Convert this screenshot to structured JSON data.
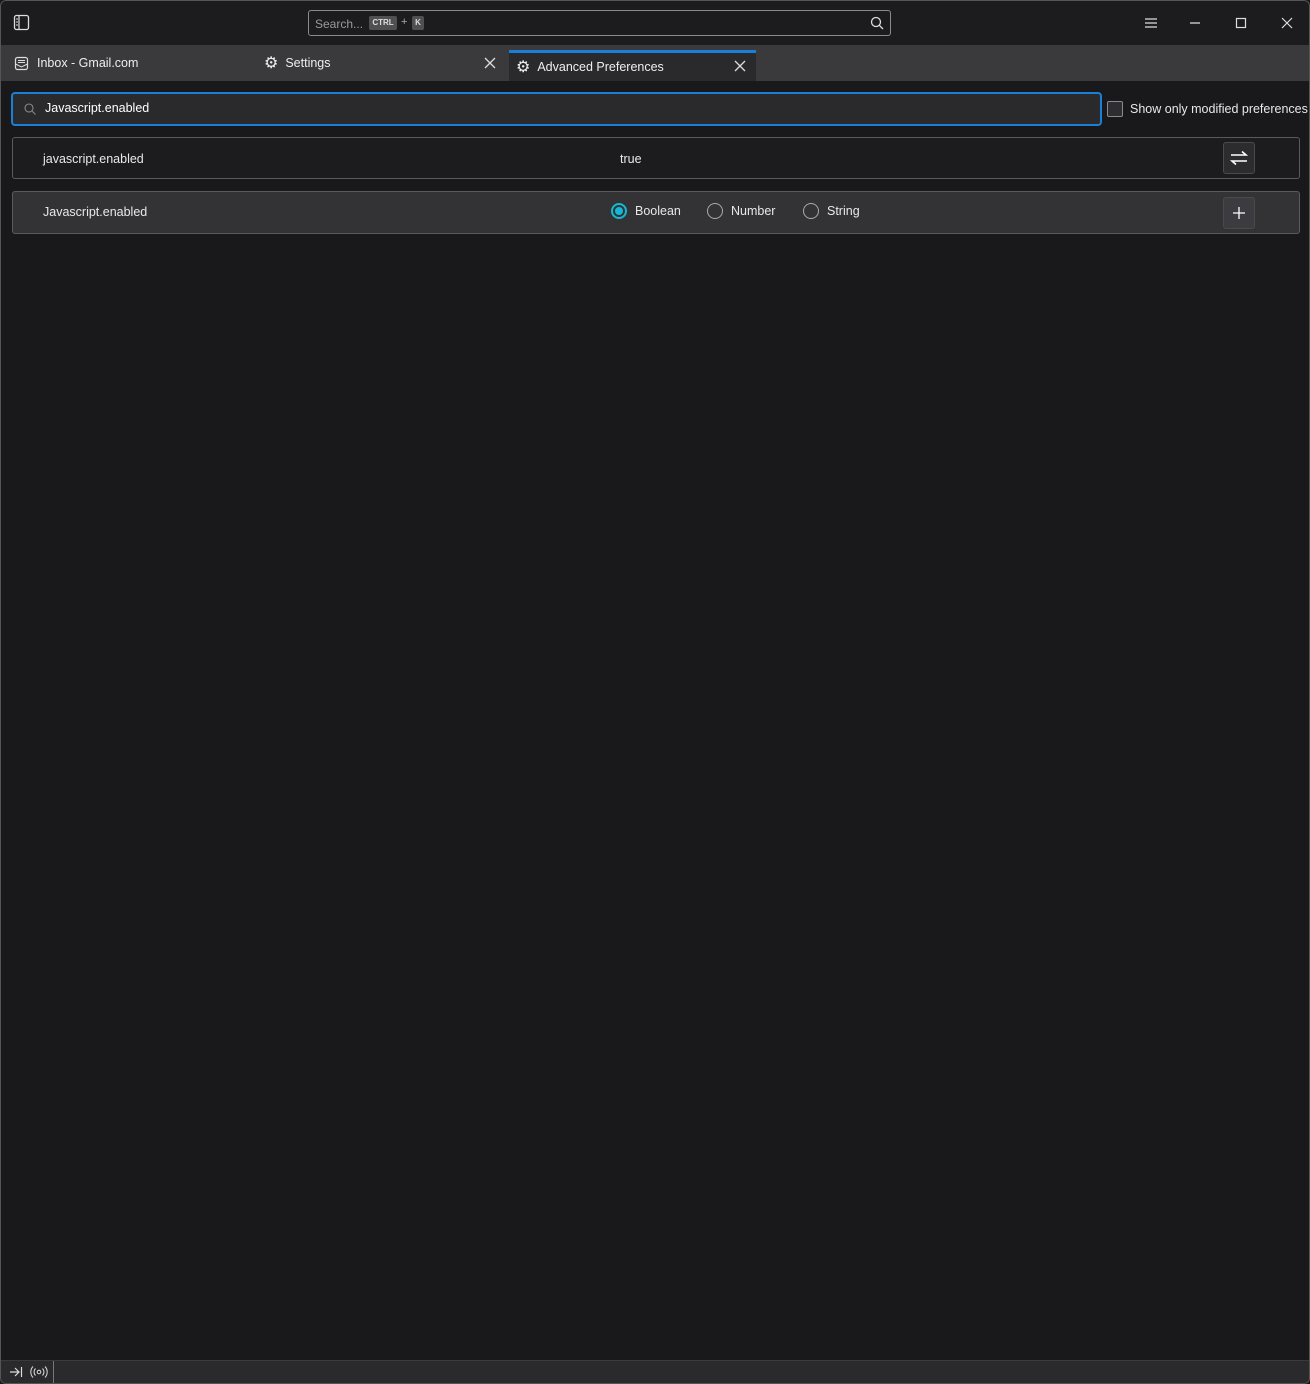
{
  "titlebar": {
    "search_placeholder": "Search...",
    "kbd_ctrl": "CTRL",
    "kbd_plus": "+",
    "kbd_k": "K"
  },
  "tabs": [
    {
      "label": "Inbox - Gmail.com",
      "icon": "mail-icon"
    },
    {
      "label": "Settings",
      "icon": "gear-icon"
    },
    {
      "label": "Advanced Preferences",
      "icon": "gear-icon",
      "active": true
    }
  ],
  "search": {
    "value": "Javascript.enabled"
  },
  "filter": {
    "label": "Show only modified preferences",
    "checked": false
  },
  "prefs": [
    {
      "name": "javascript.enabled",
      "value": "true"
    }
  ],
  "new_pref": {
    "name": "Javascript.enabled",
    "types": [
      "Boolean",
      "Number",
      "String"
    ],
    "selected": "Boolean"
  },
  "colors": {
    "accent": "#1a7fd6",
    "radio": "#14b8d4"
  }
}
